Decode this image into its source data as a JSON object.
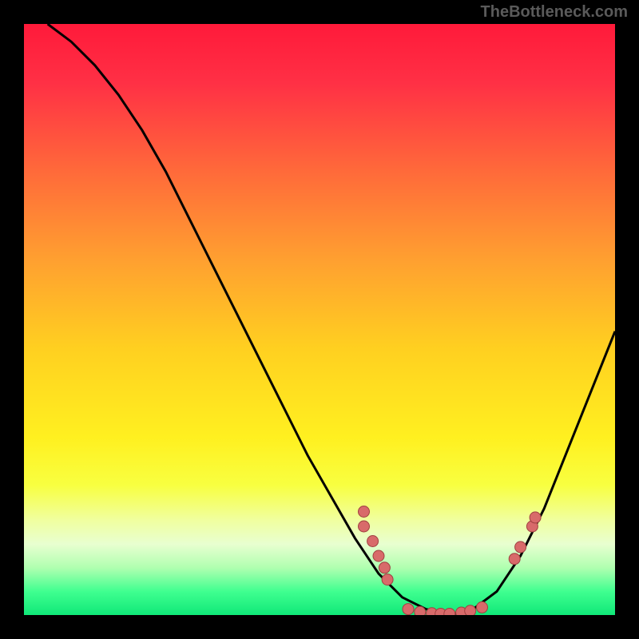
{
  "watermark": "TheBottleneck.com",
  "gradient": {
    "stops": [
      {
        "offset": 0.0,
        "color": "#ff1a3a"
      },
      {
        "offset": 0.1,
        "color": "#ff3045"
      },
      {
        "offset": 0.25,
        "color": "#ff6a3a"
      },
      {
        "offset": 0.4,
        "color": "#ffa030"
      },
      {
        "offset": 0.55,
        "color": "#ffd020"
      },
      {
        "offset": 0.7,
        "color": "#fff020"
      },
      {
        "offset": 0.78,
        "color": "#f8ff40"
      },
      {
        "offset": 0.84,
        "color": "#f0ffa0"
      },
      {
        "offset": 0.88,
        "color": "#e8ffd0"
      },
      {
        "offset": 0.92,
        "color": "#b0ffb0"
      },
      {
        "offset": 0.96,
        "color": "#40ff90"
      },
      {
        "offset": 1.0,
        "color": "#10e878"
      }
    ]
  },
  "chart_data": {
    "type": "line",
    "title": "",
    "xlabel": "",
    "ylabel": "",
    "xlim": [
      0,
      100
    ],
    "ylim": [
      0,
      100
    ],
    "series": [
      {
        "name": "curve",
        "x": [
          4,
          8,
          12,
          16,
          20,
          24,
          28,
          32,
          36,
          40,
          44,
          48,
          52,
          56,
          60,
          64,
          68,
          72,
          76,
          80,
          84,
          88,
          92,
          96,
          100
        ],
        "y": [
          100,
          97,
          93,
          88,
          82,
          75,
          67,
          59,
          51,
          43,
          35,
          27,
          20,
          13,
          7,
          3,
          1,
          0,
          1,
          4,
          10,
          18,
          28,
          38,
          48
        ]
      }
    ],
    "curve_color": "#000000",
    "markers": {
      "color": "#d86a6a",
      "stroke": "#a04040",
      "radius": 7,
      "points": [
        {
          "x": 57.5,
          "y": 17.5
        },
        {
          "x": 57.5,
          "y": 15.0
        },
        {
          "x": 59.0,
          "y": 12.5
        },
        {
          "x": 60.0,
          "y": 10.0
        },
        {
          "x": 61.0,
          "y": 8.0
        },
        {
          "x": 61.5,
          "y": 6.0
        },
        {
          "x": 65.0,
          "y": 1.0
        },
        {
          "x": 67.0,
          "y": 0.5
        },
        {
          "x": 69.0,
          "y": 0.3
        },
        {
          "x": 70.5,
          "y": 0.2
        },
        {
          "x": 72.0,
          "y": 0.2
        },
        {
          "x": 74.0,
          "y": 0.4
        },
        {
          "x": 75.5,
          "y": 0.7
        },
        {
          "x": 77.5,
          "y": 1.3
        },
        {
          "x": 83.0,
          "y": 9.5
        },
        {
          "x": 84.0,
          "y": 11.5
        },
        {
          "x": 86.0,
          "y": 15.0
        },
        {
          "x": 86.5,
          "y": 16.5
        }
      ]
    }
  }
}
